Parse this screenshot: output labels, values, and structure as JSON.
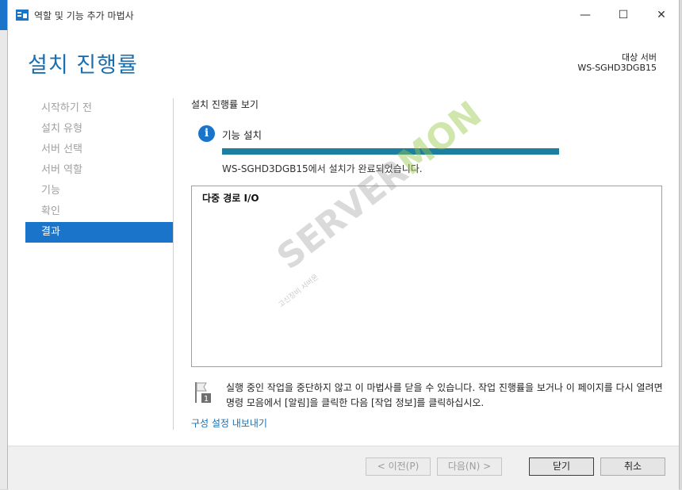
{
  "window": {
    "title": "역할 및 기능 추가 마법사",
    "controls": {
      "minimize": "—",
      "maximize": "☐",
      "close": "✕"
    }
  },
  "header": {
    "title": "설치 진행률",
    "target_label": "대상 서버",
    "target_value": "WS-SGHD3DGB15"
  },
  "nav": {
    "items": [
      {
        "label": "시작하기 전",
        "active": false
      },
      {
        "label": "설치 유형",
        "active": false
      },
      {
        "label": "서버 선택",
        "active": false
      },
      {
        "label": "서버 역할",
        "active": false
      },
      {
        "label": "기능",
        "active": false
      },
      {
        "label": "확인",
        "active": false
      },
      {
        "label": "결과",
        "active": true
      }
    ]
  },
  "main": {
    "section_title": "설치 진행률 보기",
    "feature_label": "기능 설치",
    "progress_fraction": 1.0,
    "status_text": "WS-SGHD3DGB15에서 설치가 완료되었습니다.",
    "results": [
      "다중 경로 I/O"
    ],
    "note": "실행 중인 작업을 중단하지 않고 이 마법사를 닫을 수 있습니다. 작업 진행률을 보거나 이 페이지를 다시 열려면 명령 모음에서 [알림]을 클릭한 다음 [작업 정보]를 클릭하십시오.",
    "export_link": "구성 설정 내보내기"
  },
  "footer": {
    "prev_label": "< 이전(P)",
    "next_label": "다음(N) >",
    "close_label": "닫기",
    "cancel_label": "취소"
  },
  "watermark": {
    "text_a": "SERVER",
    "text_b": "MON",
    "small": "고신장비 서버몬"
  },
  "colors": {
    "accent": "#1a74c9",
    "progress": "#1c7fa0",
    "title": "#1a6fb0"
  }
}
